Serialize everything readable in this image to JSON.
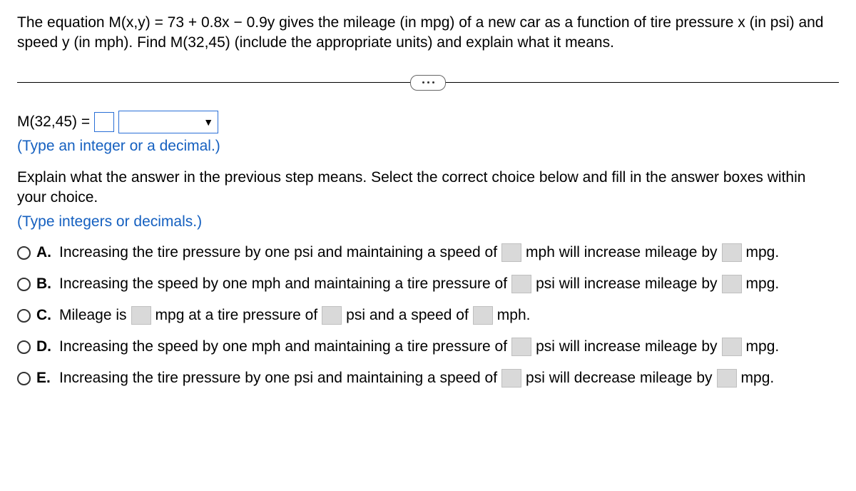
{
  "question": "The equation M(x,y) = 73 + 0.8x − 0.9y gives the mileage (in mpg) of a new car as a function of tire pressure x (in psi) and speed y (in mph). Find M(32,45) (include the appropriate units) and explain what it means.",
  "answer_label": "M(32,45) =",
  "hint1": "(Type an integer or a decimal.)",
  "explain": "Explain what the answer in the previous step means. Select the correct choice below and fill in the answer boxes within your choice.",
  "hint2": "(Type integers or decimals.)",
  "choices": {
    "A": {
      "label": "A.",
      "pre": "Increasing the tire pressure by one psi and maintaining a speed of",
      "mid": "mph will increase mileage by",
      "post": "mpg."
    },
    "B": {
      "label": "B.",
      "pre": "Increasing the speed by one mph and maintaining a tire pressure of",
      "mid": "psi will increase mileage by",
      "post": "mpg."
    },
    "C": {
      "label": "C.",
      "t1": "Mileage is",
      "t2": "mpg at a tire pressure of",
      "t3": "psi and a speed of",
      "t4": "mph."
    },
    "D": {
      "label": "D.",
      "pre": "Increasing the speed by one mph and maintaining a tire pressure of",
      "mid": "psi will increase mileage by",
      "post": "mpg."
    },
    "E": {
      "label": "E.",
      "pre": "Increasing the tire pressure by one psi and maintaining a speed of",
      "mid": "psi will decrease mileage by",
      "post": "mpg."
    }
  }
}
